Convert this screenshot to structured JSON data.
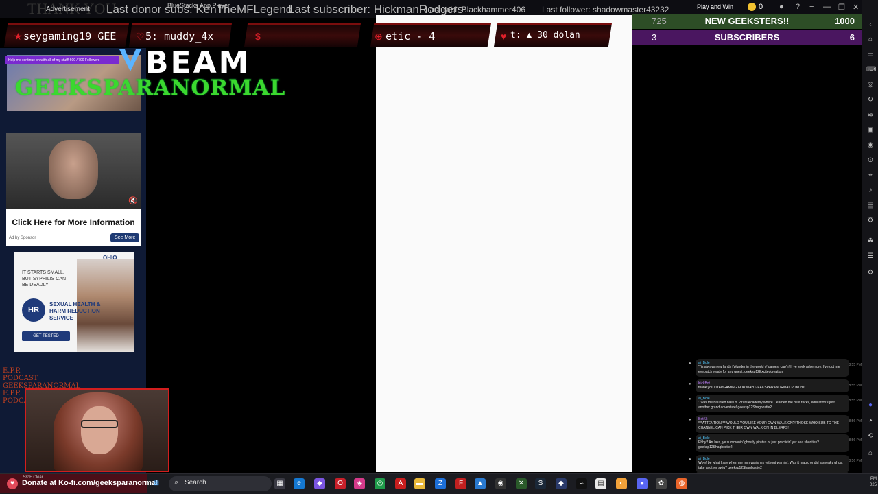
{
  "ticker": {
    "thank_you": "THANK YOU",
    "advertisement": "Advertisement",
    "app_title": "BlueStacks App Player",
    "donor": "Last donor subs: KenTheMFLegend",
    "subscriber": "Last subscriber: HickmanRodgers",
    "raid": "Last raid: Blackhammer406",
    "follower": "Last follower: shadowmaster43232",
    "play_and_win": "Play and Win",
    "coins": "0"
  },
  "alerts": [
    {
      "text": "seygaming19  GEE"
    },
    {
      "text": "5: muddy_4x"
    },
    {
      "text": "etic - 4"
    },
    {
      "text": "t: ▲ 30  dolan"
    }
  ],
  "goals": [
    {
      "current": "725",
      "label": "NEW GEEKSTERS!!",
      "target": "1000"
    },
    {
      "current": "3",
      "label": "SUBSCRIBERS",
      "target": "6"
    }
  ],
  "logo": {
    "beam": "BEAM",
    "brand": "GEEKSPARANORMAL"
  },
  "follow_bar": {
    "text": "Help me continue on with all of my stuff!    600 / 700 Followers"
  },
  "ad1": {
    "cta": "Click Here for More Information",
    "adby": "Ad by Sponsor",
    "see_more": "See More"
  },
  "ad2": {
    "brand": "OHIO",
    "line1": "IT STARTS SMALL, BUT SYPHILIS CAN BE DEADLY",
    "logo": "HR SH",
    "title": "SEXUAL HEALTH & HARM REDUCTION SERVICE",
    "button": "GET TESTED"
  },
  "podcast": {
    "text": "E.P.P. PODCAST GEEKSPARANORMAL E.P.P. PODCAST"
  },
  "chat": [
    {
      "user": "ai_Bole",
      "color": "#4fc3f7",
      "msg": "'Tis always new lands t'plunder in the world o' games, cap'n! If ye seek adventure, I've got me eyepatch ready for any quest. geeksp12Excitedcreation",
      "time": "8:55 PM"
    },
    {
      "user": "KickBot",
      "color": "#c080ff",
      "msg": "thank you DYAPGAMING FOR MAH GEEKSPARANORMAL PUKOYI!",
      "time": "8:55 PM"
    },
    {
      "user": "ai_Bole",
      "color": "#4fc3f7",
      "msg": "'Twas the haunted halls o' Pirate Academy where I learned me best tricks, education's just another grand adventure! geeksp12Shaghostie2",
      "time": "8:55 PM"
    },
    {
      "user": "BotKk",
      "color": "#c080ff",
      "msg": "***ATTENTION*** WOULD YOU LIKE YOUR OWN WALK ON?! THOSE WHO SUB TO THE CHANNEL CAN PICK THEIR OWN WALK ON IN BLERPS!",
      "time": "8:56 PM"
    },
    {
      "user": "ai_Bole",
      "color": "#4fc3f7",
      "msg": "Ebby? Arr lass, ye summonin' ghostly pirates or just practicin' yer sea shanties? geeksp12Shaghostie2",
      "time": "8:56 PM"
    },
    {
      "user": "ai_Bole",
      "color": "#4fc3f7",
      "msg": "Wow! be what I say when me rum vanishes without warnin'. Was it magic or did a sneaky ghost take another swig? geeksp12Shaghostie2",
      "time": "8:56 PM"
    },
    {
      "user": "ai_Bole",
      "color": "#4fc3f7",
      "msg": "'Tis alright cap'n! Even if ye be lost at sea for a thousand weeks, just hoist yer sails an' follow the wind, ye'll find treasure yet! geeksp12Excitedcreation",
      "time": "8:57 PM"
    }
  ],
  "taskbar": {
    "kofi": "Donate at Ko-fi.com/geeksparanormal",
    "weather": "58°F Clear",
    "search": "Search",
    "time": "PM",
    "date": "025"
  }
}
